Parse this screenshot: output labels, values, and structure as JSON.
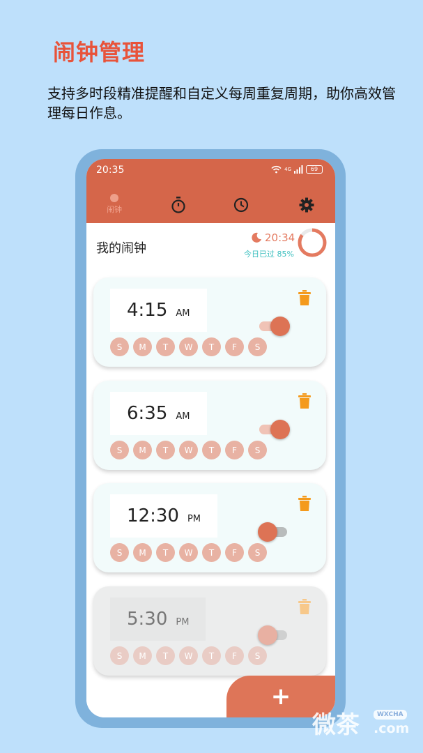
{
  "promo": {
    "title": "闹钟管理",
    "subtitle": "支持多时段精准提醒和自定义每周重复周期，助你高效管理每日作息。"
  },
  "status_bar": {
    "time": "20:35",
    "signal": "4G",
    "battery": "69"
  },
  "tabs": [
    {
      "label": "闹钟",
      "icon": "alarm-dot-icon",
      "active": true
    },
    {
      "label": "",
      "icon": "stopwatch-icon"
    },
    {
      "label": "",
      "icon": "clock-icon"
    },
    {
      "label": "",
      "icon": "gear-icon"
    }
  ],
  "header": {
    "title": "我的闹钟",
    "current_time": "20:34",
    "progress_label": "今日已过 85%",
    "progress_value": 0.85
  },
  "alarms": [
    {
      "time": "4:15",
      "ampm": "AM",
      "enabled": true,
      "disabled_style": false,
      "days": [
        "S",
        "M",
        "T",
        "W",
        "T",
        "F",
        "S"
      ]
    },
    {
      "time": "6:35",
      "ampm": "AM",
      "enabled": true,
      "disabled_style": false,
      "days": [
        "S",
        "M",
        "T",
        "W",
        "T",
        "F",
        "S"
      ]
    },
    {
      "time": "12:30",
      "ampm": "PM",
      "enabled": false,
      "disabled_style": false,
      "days": [
        "S",
        "M",
        "T",
        "W",
        "T",
        "F",
        "S"
      ]
    },
    {
      "time": "5:30",
      "ampm": "PM",
      "enabled": false,
      "disabled_style": true,
      "days": [
        "S",
        "M",
        "T",
        "W",
        "T",
        "F",
        "S"
      ]
    }
  ],
  "fab": {
    "label": "+"
  },
  "watermark": {
    "cn": "微茶",
    "badge": "WXCHA",
    "suffix": ".com"
  },
  "colors": {
    "accent": "#d5664a",
    "title_red": "#e8533a",
    "trash": "#f49a1c",
    "teal": "#40c0c0"
  }
}
